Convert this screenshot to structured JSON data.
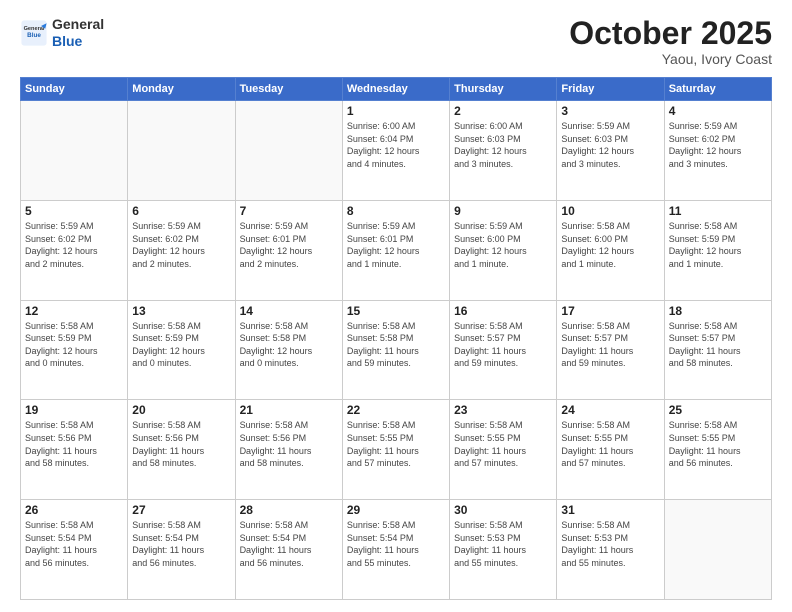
{
  "header": {
    "logo_general": "General",
    "logo_blue": "Blue",
    "month": "October 2025",
    "location": "Yaou, Ivory Coast"
  },
  "days_of_week": [
    "Sunday",
    "Monday",
    "Tuesday",
    "Wednesday",
    "Thursday",
    "Friday",
    "Saturday"
  ],
  "weeks": [
    [
      {
        "day": "",
        "info": ""
      },
      {
        "day": "",
        "info": ""
      },
      {
        "day": "",
        "info": ""
      },
      {
        "day": "1",
        "info": "Sunrise: 6:00 AM\nSunset: 6:04 PM\nDaylight: 12 hours\nand 4 minutes."
      },
      {
        "day": "2",
        "info": "Sunrise: 6:00 AM\nSunset: 6:03 PM\nDaylight: 12 hours\nand 3 minutes."
      },
      {
        "day": "3",
        "info": "Sunrise: 5:59 AM\nSunset: 6:03 PM\nDaylight: 12 hours\nand 3 minutes."
      },
      {
        "day": "4",
        "info": "Sunrise: 5:59 AM\nSunset: 6:02 PM\nDaylight: 12 hours\nand 3 minutes."
      }
    ],
    [
      {
        "day": "5",
        "info": "Sunrise: 5:59 AM\nSunset: 6:02 PM\nDaylight: 12 hours\nand 2 minutes."
      },
      {
        "day": "6",
        "info": "Sunrise: 5:59 AM\nSunset: 6:02 PM\nDaylight: 12 hours\nand 2 minutes."
      },
      {
        "day": "7",
        "info": "Sunrise: 5:59 AM\nSunset: 6:01 PM\nDaylight: 12 hours\nand 2 minutes."
      },
      {
        "day": "8",
        "info": "Sunrise: 5:59 AM\nSunset: 6:01 PM\nDaylight: 12 hours\nand 1 minute."
      },
      {
        "day": "9",
        "info": "Sunrise: 5:59 AM\nSunset: 6:00 PM\nDaylight: 12 hours\nand 1 minute."
      },
      {
        "day": "10",
        "info": "Sunrise: 5:58 AM\nSunset: 6:00 PM\nDaylight: 12 hours\nand 1 minute."
      },
      {
        "day": "11",
        "info": "Sunrise: 5:58 AM\nSunset: 5:59 PM\nDaylight: 12 hours\nand 1 minute."
      }
    ],
    [
      {
        "day": "12",
        "info": "Sunrise: 5:58 AM\nSunset: 5:59 PM\nDaylight: 12 hours\nand 0 minutes."
      },
      {
        "day": "13",
        "info": "Sunrise: 5:58 AM\nSunset: 5:59 PM\nDaylight: 12 hours\nand 0 minutes."
      },
      {
        "day": "14",
        "info": "Sunrise: 5:58 AM\nSunset: 5:58 PM\nDaylight: 12 hours\nand 0 minutes."
      },
      {
        "day": "15",
        "info": "Sunrise: 5:58 AM\nSunset: 5:58 PM\nDaylight: 11 hours\nand 59 minutes."
      },
      {
        "day": "16",
        "info": "Sunrise: 5:58 AM\nSunset: 5:57 PM\nDaylight: 11 hours\nand 59 minutes."
      },
      {
        "day": "17",
        "info": "Sunrise: 5:58 AM\nSunset: 5:57 PM\nDaylight: 11 hours\nand 59 minutes."
      },
      {
        "day": "18",
        "info": "Sunrise: 5:58 AM\nSunset: 5:57 PM\nDaylight: 11 hours\nand 58 minutes."
      }
    ],
    [
      {
        "day": "19",
        "info": "Sunrise: 5:58 AM\nSunset: 5:56 PM\nDaylight: 11 hours\nand 58 minutes."
      },
      {
        "day": "20",
        "info": "Sunrise: 5:58 AM\nSunset: 5:56 PM\nDaylight: 11 hours\nand 58 minutes."
      },
      {
        "day": "21",
        "info": "Sunrise: 5:58 AM\nSunset: 5:56 PM\nDaylight: 11 hours\nand 58 minutes."
      },
      {
        "day": "22",
        "info": "Sunrise: 5:58 AM\nSunset: 5:55 PM\nDaylight: 11 hours\nand 57 minutes."
      },
      {
        "day": "23",
        "info": "Sunrise: 5:58 AM\nSunset: 5:55 PM\nDaylight: 11 hours\nand 57 minutes."
      },
      {
        "day": "24",
        "info": "Sunrise: 5:58 AM\nSunset: 5:55 PM\nDaylight: 11 hours\nand 57 minutes."
      },
      {
        "day": "25",
        "info": "Sunrise: 5:58 AM\nSunset: 5:55 PM\nDaylight: 11 hours\nand 56 minutes."
      }
    ],
    [
      {
        "day": "26",
        "info": "Sunrise: 5:58 AM\nSunset: 5:54 PM\nDaylight: 11 hours\nand 56 minutes."
      },
      {
        "day": "27",
        "info": "Sunrise: 5:58 AM\nSunset: 5:54 PM\nDaylight: 11 hours\nand 56 minutes."
      },
      {
        "day": "28",
        "info": "Sunrise: 5:58 AM\nSunset: 5:54 PM\nDaylight: 11 hours\nand 56 minutes."
      },
      {
        "day": "29",
        "info": "Sunrise: 5:58 AM\nSunset: 5:54 PM\nDaylight: 11 hours\nand 55 minutes."
      },
      {
        "day": "30",
        "info": "Sunrise: 5:58 AM\nSunset: 5:53 PM\nDaylight: 11 hours\nand 55 minutes."
      },
      {
        "day": "31",
        "info": "Sunrise: 5:58 AM\nSunset: 5:53 PM\nDaylight: 11 hours\nand 55 minutes."
      },
      {
        "day": "",
        "info": ""
      }
    ]
  ]
}
